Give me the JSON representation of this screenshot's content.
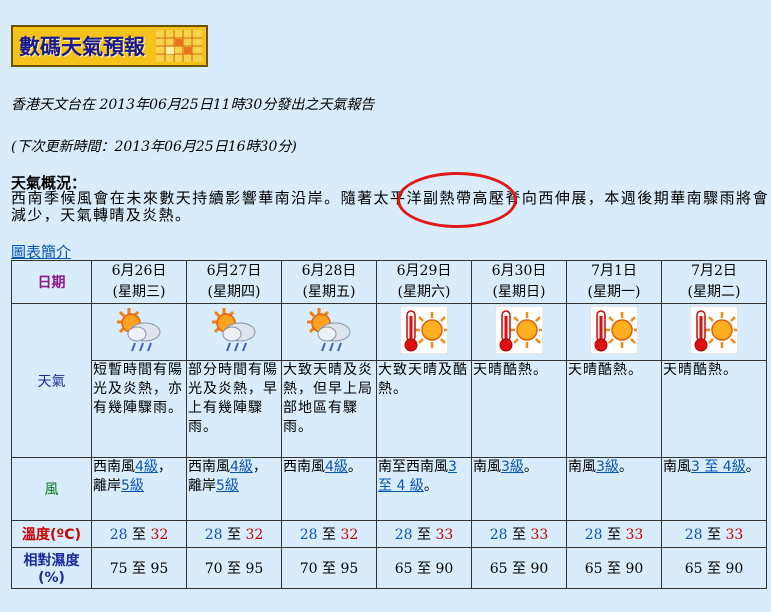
{
  "logo": {
    "text": "數碼天氣預報"
  },
  "report": {
    "issued": "香港天文台在 2013年06月25日11時30分發出之天氣報告",
    "next_update": "(下次更新時間：2013年06月25日16時30分)"
  },
  "overview": {
    "title": "天氣概況：",
    "text": "西南季候風會在未來數天持續影響華南沿岸。隨著太平洋副熱帶高壓脊向西伸展，本週後期華南驟雨將會減少，天氣轉晴及炎熱。"
  },
  "chart_intro_link": "圖表簡介",
  "table": {
    "row_labels": {
      "date": "日期",
      "weather": "天氣",
      "wind": "風",
      "temp": "溫度(ºC)",
      "rh": "相對濕度(%)"
    },
    "days": [
      {
        "date": "6月26日",
        "weekday": "(星期三)",
        "icon": "sun-cloud-rain-icon",
        "weather": "短暫時間有陽光及炎熱，亦有幾陣驟雨。",
        "wind_pre": "西南風",
        "wind_link": "4級",
        "wind_mid": "，離岸",
        "wind_link2": "5級",
        "wind_post": "",
        "t_min": "28",
        "t_to": "至",
        "t_max": "32",
        "rh": "75 至 95"
      },
      {
        "date": "6月27日",
        "weekday": "(星期四)",
        "icon": "sun-cloud-rain-icon",
        "weather": "部分時間有陽光及炎熱，早上有幾陣驟雨。",
        "wind_pre": "西南風",
        "wind_link": "4級",
        "wind_mid": "，離岸",
        "wind_link2": "5級",
        "wind_post": "",
        "t_min": "28",
        "t_to": "至",
        "t_max": "32",
        "rh": "70 至 95"
      },
      {
        "date": "6月28日",
        "weekday": "(星期五)",
        "icon": "sun-cloud-rain-icon",
        "weather": "大致天晴及炎熱，但早上局部地區有驟雨。",
        "wind_pre": "西南風",
        "wind_link": "4級",
        "wind_mid": "",
        "wind_link2": "",
        "wind_post": "。",
        "t_min": "28",
        "t_to": "至",
        "t_max": "32",
        "rh": "70 至 95"
      },
      {
        "date": "6月29日",
        "weekday": "(星期六)",
        "icon": "very-hot-icon",
        "weather": "大致天晴及酷熱。",
        "wind_pre": "南至西南風",
        "wind_link": "3 至 4 級",
        "wind_mid": "",
        "wind_link2": "",
        "wind_post": "。",
        "t_min": "28",
        "t_to": "至",
        "t_max": "33",
        "rh": "65 至 90"
      },
      {
        "date": "6月30日",
        "weekday": "(星期日)",
        "icon": "very-hot-icon",
        "weather": "天晴酷熱。",
        "wind_pre": "南風",
        "wind_link": "3級",
        "wind_mid": "",
        "wind_link2": "",
        "wind_post": "。",
        "t_min": "28",
        "t_to": "至",
        "t_max": "33",
        "rh": "65 至 90"
      },
      {
        "date": "7月1日",
        "weekday": "(星期一)",
        "icon": "very-hot-icon",
        "weather": "天晴酷熱。",
        "wind_pre": "南風",
        "wind_link": "3級",
        "wind_mid": "",
        "wind_link2": "",
        "wind_post": "。",
        "t_min": "28",
        "t_to": "至",
        "t_max": "33",
        "rh": "65 至 90"
      },
      {
        "date": "7月2日",
        "weekday": "(星期二)",
        "icon": "very-hot-icon",
        "weather": "天晴酷熱。",
        "wind_pre": "南風",
        "wind_link": "3 至 4",
        "wind_mid": "",
        "wind_link2": "級",
        "wind_post": "。",
        "t_min": "28",
        "t_to": "至",
        "t_max": "33",
        "rh": "65 至 90"
      }
    ]
  },
  "colors": {
    "background": "#d8ecfb",
    "link": "#0a55b4",
    "temp_max": "#c80000",
    "highlight_ring": "#e01818"
  }
}
